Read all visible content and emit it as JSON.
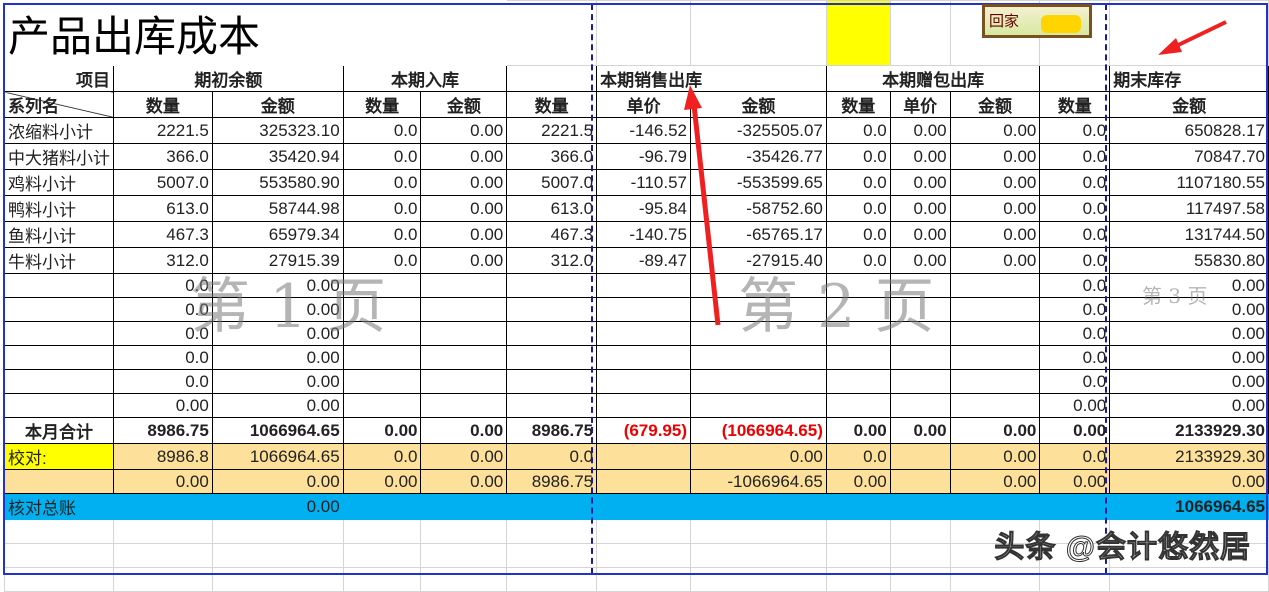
{
  "title": "产品出库成本",
  "header": {
    "item": "项目",
    "series": "系列名",
    "opening": "期初余额",
    "inbound": "本期入库",
    "sales_out": "本期销售出库",
    "gift_out": "本期赠包出库",
    "ending": "期末库存",
    "qty": "数量",
    "amount": "金额",
    "unit_price": "单价"
  },
  "rows": [
    [
      "浓缩料小计",
      "2221.5",
      "325323.10",
      "0.0",
      "0.00",
      "2221.5",
      "-146.52",
      "-325505.07",
      "0.0",
      "0.00",
      "0.00",
      "0.0",
      "650828.17"
    ],
    [
      "中大猪料小计",
      "366.0",
      "35420.94",
      "0.0",
      "0.00",
      "366.0",
      "-96.79",
      "-35426.77",
      "0.0",
      "0.00",
      "0.00",
      "0.0",
      "70847.70"
    ],
    [
      "鸡料小计",
      "5007.0",
      "553580.90",
      "0.0",
      "0.00",
      "5007.0",
      "-110.57",
      "-553599.65",
      "0.0",
      "0.00",
      "0.00",
      "0.0",
      "1107180.55"
    ],
    [
      "鸭料小计",
      "613.0",
      "58744.98",
      "0.0",
      "0.00",
      "613.0",
      "-95.84",
      "-58752.60",
      "0.0",
      "0.00",
      "0.00",
      "0.0",
      "117497.58"
    ],
    [
      "鱼料小计",
      "467.3",
      "65979.34",
      "0.0",
      "0.00",
      "467.3",
      "-140.75",
      "-65765.17",
      "0.0",
      "0.00",
      "0.00",
      "0.0",
      "131744.50"
    ],
    [
      "牛料小计",
      "312.0",
      "27915.39",
      "0.0",
      "0.00",
      "312.0",
      "-89.47",
      "-27915.40",
      "0.0",
      "0.00",
      "0.00",
      "0.0",
      "55830.80"
    ]
  ],
  "empty_rows": [
    [
      "0.0",
      "0.00",
      "0.0",
      "0.00"
    ],
    [
      "0.0",
      "0.00",
      "0.0",
      "0.00"
    ],
    [
      "0.0",
      "0.00",
      "0.0",
      "0.00"
    ],
    [
      "0.0",
      "0.00",
      "0.0",
      "0.00"
    ],
    [
      "0.0",
      "0.00",
      "0.0",
      "0.00"
    ],
    [
      "0.00",
      "0.00",
      "0.00",
      "0.00"
    ]
  ],
  "total": [
    "本月合计",
    "8986.75",
    "1066964.65",
    "0.00",
    "0.00",
    "8986.75",
    "(679.95)",
    "(1066964.65)",
    "0.00",
    "0.00",
    "0.00",
    "0.00",
    "2133929.30"
  ],
  "check": [
    "校对:",
    "8986.8",
    "1066964.65",
    "0.0",
    "0.00",
    "0.0",
    "",
    "0.00",
    "0.0",
    "",
    "0.00",
    "0.0",
    "2133929.30"
  ],
  "check2": [
    "",
    "0.00",
    "0.00",
    "0.00",
    "0.00",
    "8986.75",
    "",
    "-1066964.65",
    "0.00",
    "",
    "0.00",
    "0.00",
    "0.00"
  ],
  "ledger": {
    "label": "核对总账",
    "value": "0.00",
    "total": "1066964.65"
  },
  "watermarks": {
    "p1": "第 1 页",
    "p2": "第 2 页",
    "p3": "第 3 页",
    "logo": "回家",
    "source": "头条 @会计悠然居"
  },
  "colors": {
    "highlight": "#ffff00",
    "check_bg": "#fde19a",
    "ledger_bg": "#00b0f0",
    "negative": "#e00000"
  }
}
